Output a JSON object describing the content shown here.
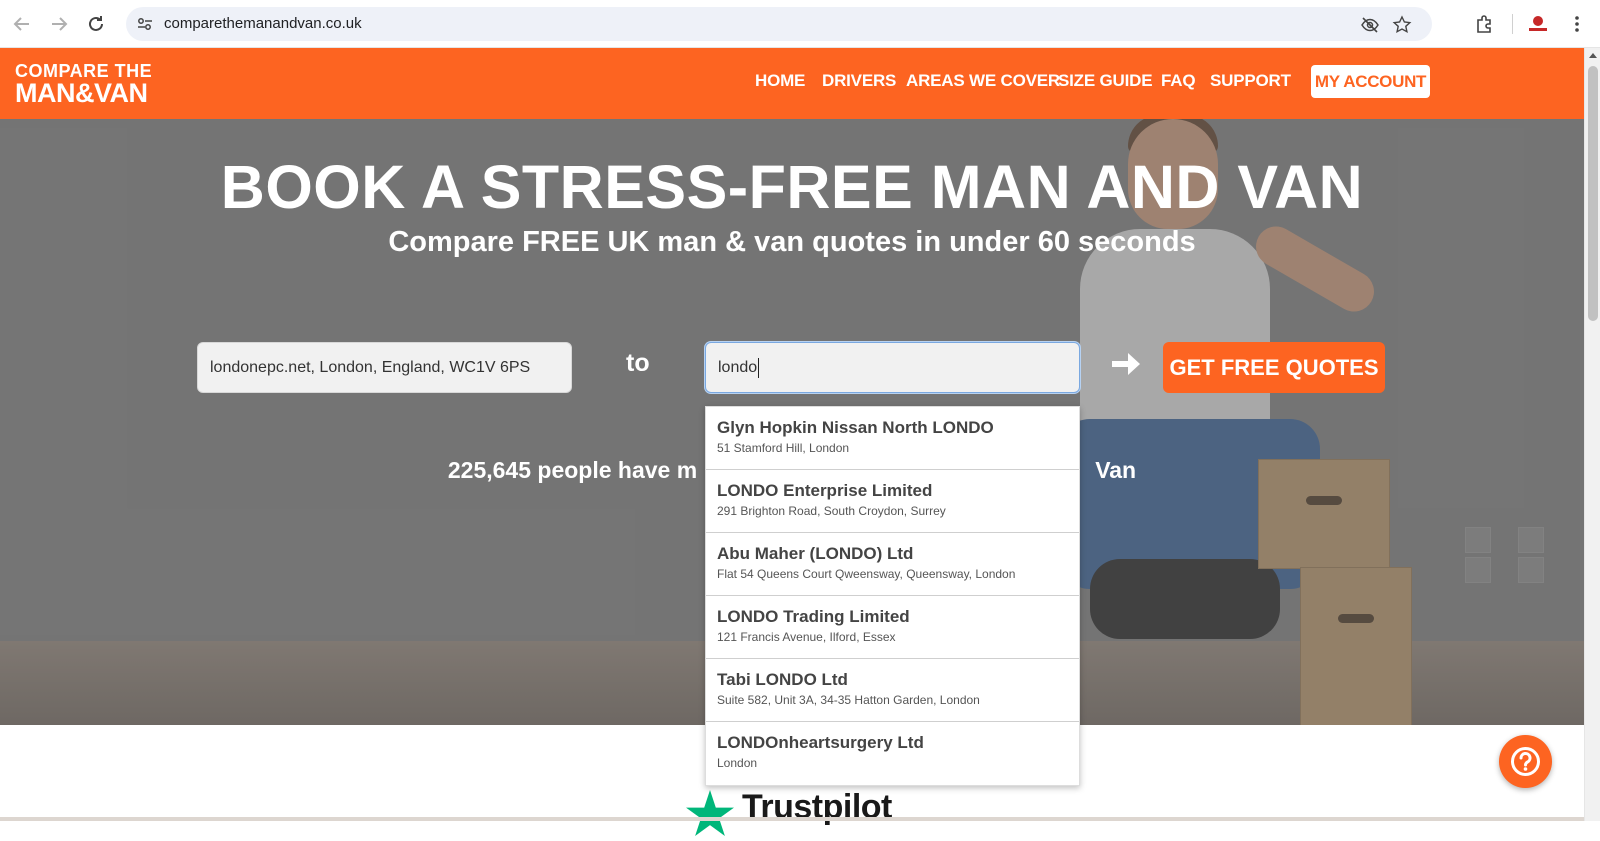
{
  "browser": {
    "url": "comparethemanandvan.co.uk",
    "icons": {
      "back": "back-arrow-icon",
      "forward": "forward-arrow-icon",
      "reload": "reload-icon",
      "site_controls": "site-settings-icon",
      "hide": "eye-slash-icon",
      "bookmark": "star-icon",
      "extensions": "puzzle-icon",
      "menu": "kebab-menu-icon"
    }
  },
  "header": {
    "logo_line1": "COMPARE THE",
    "logo_line2": "MAN&VAN",
    "nav": [
      "HOME",
      "DRIVERS",
      "AREAS WE COVER",
      "SIZE GUIDE",
      "FAQ",
      "SUPPORT"
    ],
    "account_label": "MY ACCOUNT",
    "brand_color": "#fd6421"
  },
  "hero": {
    "title": "BOOK A STRESS-FREE MAN AND VAN",
    "subtitle": "Compare FREE UK man & van quotes in under 60 seconds",
    "from_value": "londonepc.net, London, England, WC1V 6PS",
    "to_label": "to",
    "to_value": "londo",
    "cta_label": "GET FREE QUOTES",
    "stat_left": "225,645 people have m",
    "stat_right": "Van"
  },
  "suggestions": [
    {
      "name": "Glyn Hopkin Nissan North LONDO",
      "address": "51 Stamford Hill, London"
    },
    {
      "name": "LONDO Enterprise Limited",
      "address": "291 Brighton Road, South Croydon, Surrey"
    },
    {
      "name": "Abu Maher (LONDO) Ltd",
      "address": "Flat 54 Queens Court Qweensway, Queensway, London"
    },
    {
      "name": "LONDO Trading Limited",
      "address": "121 Francis Avenue, Ilford, Essex"
    },
    {
      "name": "Tabi LONDO Ltd",
      "address": "Suite 582, Unit 3A, 34-35 Hatton Garden, London"
    },
    {
      "name": "LONDOnheartsurgery Ltd",
      "address": "London"
    }
  ],
  "trustpilot": {
    "label": "Trustpilot",
    "star_color": "#00b67a"
  },
  "help": {
    "icon": "question-mark-icon"
  }
}
